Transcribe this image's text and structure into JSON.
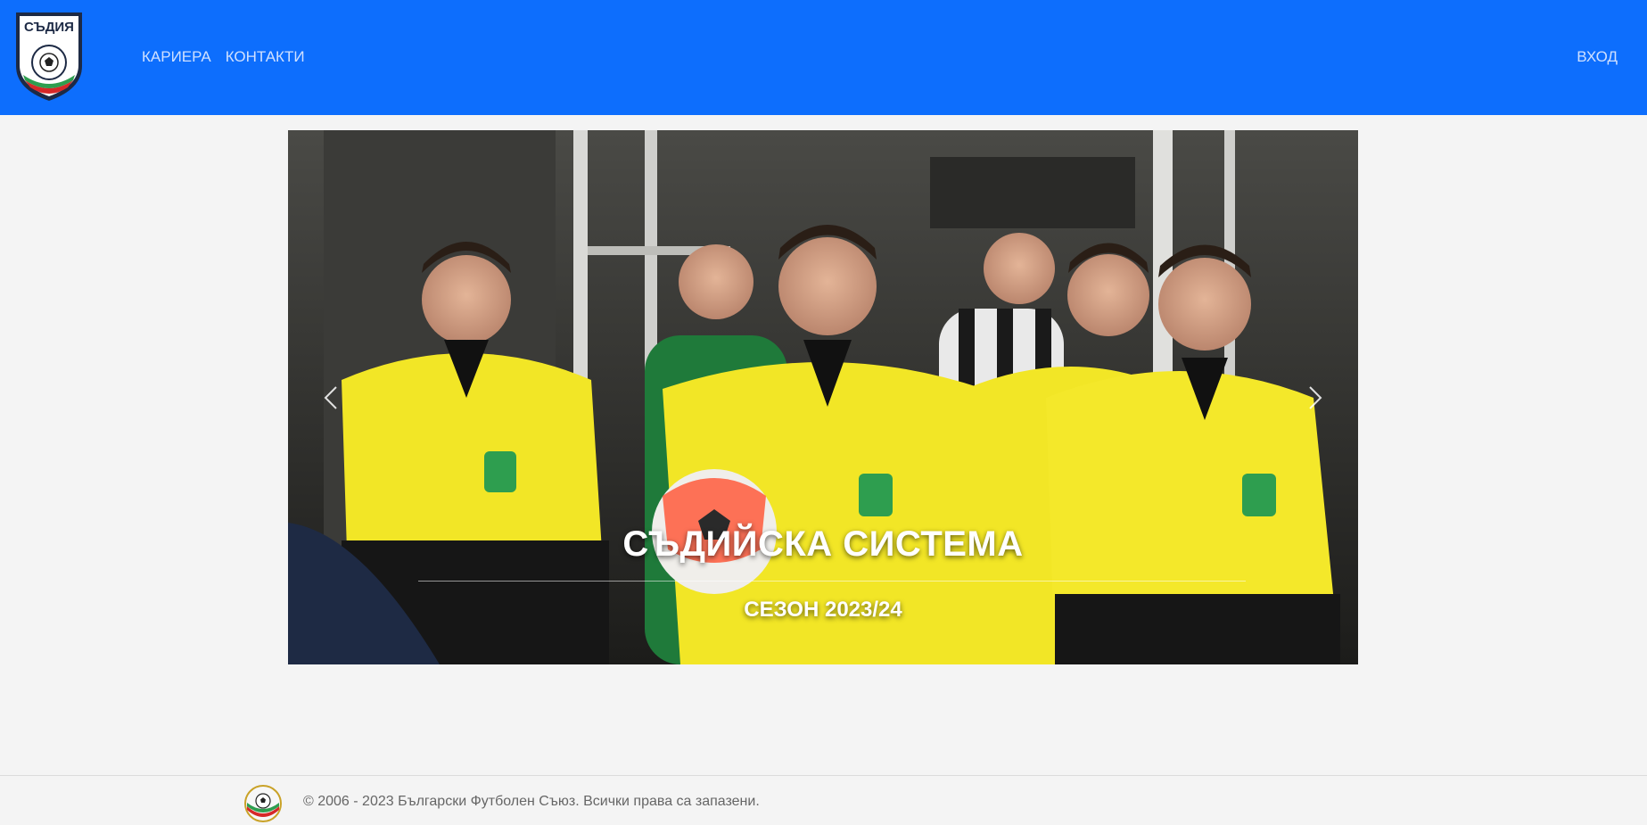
{
  "header": {
    "logo_icon": "referees-shield-logo",
    "logo_text": "СЪДИЯ",
    "nav": [
      {
        "label": "КАРИЕРА"
      },
      {
        "label": "КОНТАКТИ"
      }
    ],
    "login_label": "ВХОД",
    "brand_color": "#0d6efd"
  },
  "carousel": {
    "title": "СЪДИЙСКА СИСТЕМА",
    "subtitle": "СЕЗОН 2023/24",
    "prev_icon": "chevron-left-icon",
    "next_icon": "chevron-right-icon"
  },
  "footer": {
    "logo_icon": "bfu-round-logo",
    "copyright": "© 2006 - 2023 Български Футболен Съюз. Всички права са запазени."
  }
}
